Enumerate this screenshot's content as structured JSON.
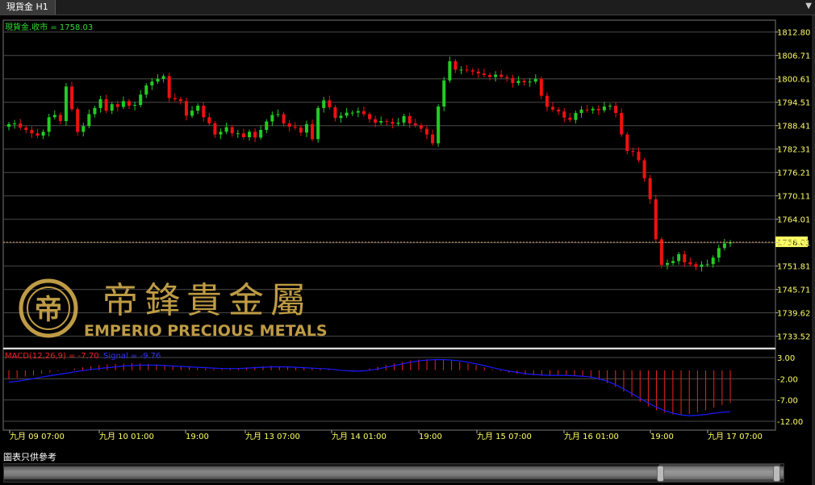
{
  "window": {
    "tab_title": "現貨金 H1",
    "menu_icon": "triangle-down-icon"
  },
  "price_panel": {
    "legend": "現貨金.收市 = 1758.03",
    "y_ticks": [
      "1812.80",
      "1806.71",
      "1800.61",
      "1794.51",
      "1788.41",
      "1782.31",
      "1776.21",
      "1770.11",
      "1764.01",
      "1757.91",
      "1751.81",
      "1745.71",
      "1739.62",
      "1733.52"
    ],
    "current_price": "1758.03",
    "current_price_value": 1758.03
  },
  "macd_panel": {
    "label_macd": "MACD(12,26,9) = -7.70",
    "label_signal": "Signal = -9.76",
    "y_ticks": [
      "3.00",
      "-2.00",
      "-7.00",
      "-12.00"
    ]
  },
  "x_axis": {
    "labels": [
      "九月 09 07:00",
      "九月 10 01:00",
      "19:00",
      "九月 13 07:00",
      "九月 14 01:00",
      "19:00",
      "九月 15 07:00",
      "九月 16 01:00",
      "19:00",
      "九月 17 07:00"
    ]
  },
  "watermark": {
    "chinese": "帝鋒貴金屬",
    "english": "EMPERIO PRECIOUS METALS",
    "logo_letter": "帝"
  },
  "footer": {
    "disclaimer": "圖表只供參考"
  },
  "colors": {
    "up": "#22cc22",
    "down": "#ee1111",
    "signal": "#1a1aff",
    "gold": "#c9a449",
    "ticks": "#ffff66"
  },
  "chart_data": [
    {
      "type": "candlestick",
      "title": "現貨金 H1",
      "series": [
        {
          "name": "現貨金.收市",
          "close": [
            1788.8,
            1789.0,
            1787.9,
            1787.3,
            1786.4,
            1785.8,
            1786.8,
            1790.6,
            1791.2,
            1789.6,
            1798.6,
            1792.7,
            1786.8,
            1788.3,
            1791.4,
            1793.0,
            1795.3,
            1792.3,
            1794.0,
            1793.3,
            1794.8,
            1793.6,
            1793.8,
            1796.5,
            1798.9,
            1799.9,
            1800.6,
            1801.3,
            1795.6,
            1795.3,
            1794.8,
            1791.0,
            1792.3,
            1793.6,
            1790.6,
            1789.0,
            1786.1,
            1786.8,
            1788.0,
            1786.4,
            1786.4,
            1785.4,
            1786.8,
            1785.3,
            1787.3,
            1789.5,
            1791.2,
            1791.4,
            1789.0,
            1788.1,
            1787.9,
            1786.6,
            1788.8,
            1784.9,
            1793.0,
            1795.0,
            1793.2,
            1790.4,
            1791.0,
            1791.8,
            1791.8,
            1792.2,
            1791.4,
            1790.1,
            1789.2,
            1789.6,
            1789.4,
            1788.9,
            1789.2,
            1790.9,
            1789.0,
            1788.5,
            1787.6,
            1786.1,
            1783.8,
            1793.4,
            1800.2,
            1805.2,
            1803.0,
            1803.0,
            1802.8,
            1802.5,
            1802.0,
            1801.6,
            1801.1,
            1801.7,
            1801.1,
            1800.8,
            1799.5,
            1800.1,
            1799.7,
            1799.9,
            1800.6,
            1796.2,
            1793.3,
            1792.6,
            1792.1,
            1790.5,
            1789.9,
            1791.7,
            1792.6,
            1792.4,
            1792.8,
            1792.4,
            1793.4,
            1793.6,
            1791.7,
            1786.1,
            1781.8,
            1781.6,
            1779.4,
            1774.7,
            1769.2,
            1758.8,
            1752.1,
            1752.6,
            1753.1,
            1754.9,
            1752.8,
            1752.3,
            1751.6,
            1752.2,
            1752.3,
            1754.0,
            1756.5,
            1757.7,
            1758.0
          ],
          "open": [
            1788.1,
            1788.8,
            1789.0,
            1787.9,
            1787.3,
            1786.4,
            1785.8,
            1786.8,
            1790.6,
            1791.2,
            1789.6,
            1798.6,
            1792.7,
            1786.8,
            1788.3,
            1791.4,
            1793.0,
            1795.3,
            1792.3,
            1794.0,
            1793.3,
            1794.8,
            1793.6,
            1793.8,
            1796.5,
            1798.9,
            1799.9,
            1800.6,
            1801.3,
            1795.6,
            1795.3,
            1794.8,
            1791.0,
            1792.3,
            1793.6,
            1790.6,
            1789.0,
            1786.1,
            1786.8,
            1788.0,
            1786.4,
            1786.4,
            1785.4,
            1786.8,
            1785.3,
            1787.3,
            1789.5,
            1791.2,
            1791.4,
            1789.0,
            1788.1,
            1787.9,
            1786.6,
            1788.8,
            1784.9,
            1793.0,
            1795.0,
            1793.2,
            1790.4,
            1791.0,
            1791.8,
            1791.8,
            1792.2,
            1791.4,
            1790.1,
            1789.2,
            1789.6,
            1789.4,
            1788.9,
            1789.2,
            1790.9,
            1789.0,
            1788.5,
            1787.6,
            1786.1,
            1783.8,
            1793.4,
            1800.2,
            1805.2,
            1803.0,
            1803.0,
            1802.8,
            1802.5,
            1802.0,
            1801.6,
            1801.1,
            1801.7,
            1801.1,
            1800.8,
            1799.5,
            1800.1,
            1799.7,
            1799.9,
            1800.6,
            1796.2,
            1793.3,
            1792.6,
            1792.1,
            1790.5,
            1789.9,
            1791.7,
            1792.6,
            1792.4,
            1792.8,
            1792.4,
            1793.4,
            1793.6,
            1791.7,
            1786.1,
            1781.8,
            1781.6,
            1779.4,
            1774.7,
            1769.2,
            1758.8,
            1752.1,
            1752.6,
            1753.1,
            1754.9,
            1752.8,
            1752.3,
            1751.6,
            1752.2,
            1752.3,
            1754.0,
            1756.5,
            1757.7
          ]
        }
      ],
      "x_labels": [
        "九月 09 07:00",
        "九月 10 01:00",
        "19:00",
        "九月 13 07:00",
        "九月 14 01:00",
        "19:00",
        "九月 15 07:00",
        "九月 16 01:00",
        "19:00",
        "九月 17 07:00"
      ],
      "ylim": [
        1730.5,
        1815.9
      ],
      "current_line": 1758.03
    },
    {
      "type": "bar+line",
      "series": [
        {
          "name": "MACD(12,26,9)",
          "values": [
            -2.0,
            -1.8,
            -1.5,
            -1.2,
            -0.8,
            -0.5,
            -0.2,
            0.1,
            0.4,
            0.7,
            1.0,
            1.2,
            1.4,
            1.5,
            1.6,
            1.7,
            1.6,
            1.5,
            1.4,
            1.3,
            1.1,
            0.9,
            0.7,
            0.5,
            0.4,
            0.3,
            0.3,
            0.4,
            0.5,
            0.7,
            0.8,
            0.9,
            1.0,
            0.9,
            0.8,
            0.7,
            0.6,
            0.5,
            0.4,
            0.2,
            0.0,
            -0.2,
            -0.2,
            0.0,
            0.4,
            0.8,
            1.2,
            1.6,
            2.0,
            2.3,
            2.5,
            2.6,
            2.6,
            2.5,
            2.3,
            2.0,
            1.6,
            1.2,
            0.7,
            0.2,
            -0.2,
            -0.6,
            -0.9,
            -1.1,
            -1.2,
            -1.3,
            -1.3,
            -1.2,
            -1.2,
            -1.3,
            -1.5,
            -1.8,
            -2.3,
            -3.0,
            -3.9,
            -5.0,
            -6.2,
            -7.4,
            -8.5,
            -9.4,
            -10.0,
            -10.4,
            -10.5,
            -10.3,
            -9.9,
            -9.4,
            -8.8,
            -8.2,
            -7.7
          ]
        },
        {
          "name": "Signal",
          "values": [
            -2.8,
            -2.6,
            -2.3,
            -2.0,
            -1.6,
            -1.3,
            -1.0,
            -0.7,
            -0.4,
            -0.1,
            0.2,
            0.4,
            0.6,
            0.8,
            1.0,
            1.1,
            1.2,
            1.2,
            1.2,
            1.1,
            1.0,
            0.9,
            0.8,
            0.7,
            0.6,
            0.5,
            0.4,
            0.4,
            0.4,
            0.5,
            0.6,
            0.7,
            0.8,
            0.8,
            0.8,
            0.7,
            0.6,
            0.5,
            0.4,
            0.3,
            0.1,
            -0.1,
            -0.2,
            -0.2,
            0.0,
            0.3,
            0.7,
            1.1,
            1.5,
            1.9,
            2.2,
            2.4,
            2.5,
            2.5,
            2.4,
            2.2,
            1.9,
            1.5,
            1.1,
            0.6,
            0.2,
            -0.2,
            -0.5,
            -0.8,
            -1.0,
            -1.1,
            -1.2,
            -1.2,
            -1.2,
            -1.3,
            -1.4,
            -1.6,
            -2.0,
            -2.6,
            -3.4,
            -4.4,
            -5.5,
            -6.6,
            -7.7,
            -8.7,
            -9.5,
            -10.1,
            -10.5,
            -10.7,
            -10.6,
            -10.4,
            -10.1,
            -9.9,
            -9.76
          ]
        }
      ],
      "ylim": [
        -13.9,
        4.9
      ],
      "y_ticks": [
        3.0,
        -2.0,
        -7.0,
        -12.0
      ]
    }
  ]
}
